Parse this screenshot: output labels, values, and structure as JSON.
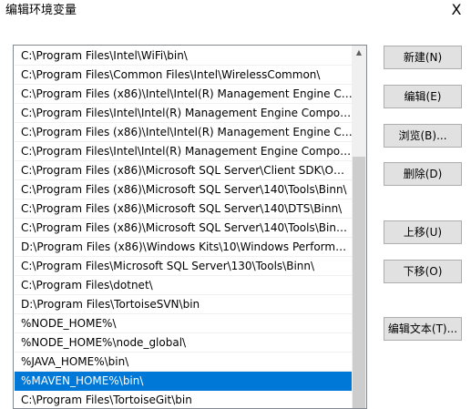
{
  "window": {
    "title": "编辑环境变量",
    "close_glyph": "X"
  },
  "path_list": {
    "items": [
      {
        "label": "C:\\Program Files\\Intel\\WiFi\\bin\\",
        "selected": false
      },
      {
        "label": "C:\\Program Files\\Common Files\\Intel\\WirelessCommon\\",
        "selected": false
      },
      {
        "label": "C:\\Program Files (x86)\\Intel\\Intel(R) Management Engine Co...",
        "selected": false
      },
      {
        "label": "C:\\Program Files\\Intel\\Intel(R) Management Engine Compon...",
        "selected": false
      },
      {
        "label": "C:\\Program Files (x86)\\Intel\\Intel(R) Management Engine Co...",
        "selected": false
      },
      {
        "label": "C:\\Program Files\\Intel\\Intel(R) Management Engine Compon...",
        "selected": false
      },
      {
        "label": "C:\\Program Files (x86)\\Microsoft SQL Server\\Client SDK\\ODB...",
        "selected": false
      },
      {
        "label": "C:\\Program Files (x86)\\Microsoft SQL Server\\140\\Tools\\Binn\\",
        "selected": false
      },
      {
        "label": "C:\\Program Files (x86)\\Microsoft SQL Server\\140\\DTS\\Binn\\",
        "selected": false
      },
      {
        "label": "C:\\Program Files (x86)\\Microsoft SQL Server\\140\\Tools\\Binn...",
        "selected": false
      },
      {
        "label": "D:\\Program Files (x86)\\Windows Kits\\10\\Windows Performan...",
        "selected": false
      },
      {
        "label": "C:\\Program Files\\Microsoft SQL Server\\130\\Tools\\Binn\\",
        "selected": false
      },
      {
        "label": "C:\\Program Files\\dotnet\\",
        "selected": false
      },
      {
        "label": "D:\\Program Files\\TortoiseSVN\\bin",
        "selected": false
      },
      {
        "label": "%NODE_HOME%\\",
        "selected": false
      },
      {
        "label": "%NODE_HOME%\\node_global\\",
        "selected": false
      },
      {
        "label": "%JAVA_HOME%\\bin\\",
        "selected": false
      },
      {
        "label": "%MAVEN_HOME%\\bin\\",
        "selected": true
      },
      {
        "label": "C:\\Program Files\\TortoiseGit\\bin",
        "selected": false
      }
    ]
  },
  "buttons": {
    "new": "新建(N)",
    "edit": "编辑(E)",
    "browse": "浏览(B)...",
    "delete": "删除(D)",
    "move_up": "上移(U)",
    "move_down": "下移(O)",
    "edit_text": "编辑文本(T)..."
  },
  "colors": {
    "selection": "#0078d7",
    "button_face": "#e1e1e1"
  }
}
